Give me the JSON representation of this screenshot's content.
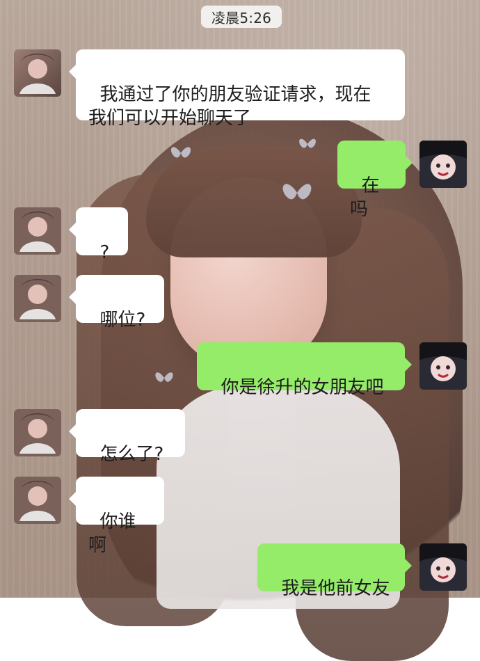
{
  "header": {
    "time": "凌晨5:26"
  },
  "messages": [
    {
      "side": "left",
      "text": "我通过了你的朋友验证请求，现在\n我们可以开始聊天了"
    },
    {
      "side": "right",
      "text": "在吗"
    },
    {
      "side": "left",
      "text": "?"
    },
    {
      "side": "left",
      "text": "哪位?"
    },
    {
      "side": "right",
      "text": "你是徐升的女朋友吧"
    },
    {
      "side": "left",
      "text": "怎么了?"
    },
    {
      "side": "left",
      "text": "你谁啊"
    },
    {
      "side": "right",
      "text": "我是他前女友"
    }
  ],
  "theme": {
    "left_bubble": "#ffffff",
    "right_bubble": "#95ec69"
  }
}
